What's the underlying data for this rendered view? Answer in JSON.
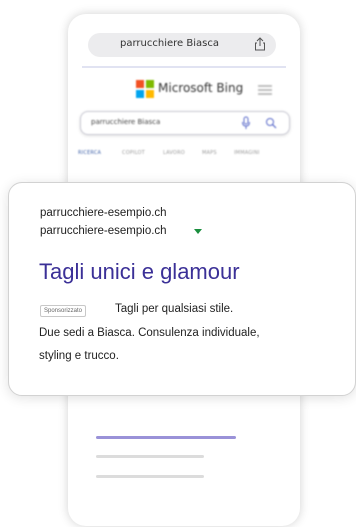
{
  "browser": {
    "url_text": "parrucchiere Biasca",
    "share_icon": "share-icon"
  },
  "bing": {
    "brand": "Microsoft Bing",
    "logo_colors": [
      "#f25022",
      "#7fba00",
      "#00a4ef",
      "#ffb900"
    ],
    "menu_icon": "hamburger-icon"
  },
  "search": {
    "query": "parrucchiere Biasca",
    "mic_icon": "microphone-icon",
    "search_icon": "search-icon"
  },
  "tabs": [
    "RICERCA",
    "COPILOT",
    "LAVORO",
    "MAPS",
    "IMMAGINI"
  ],
  "ad": {
    "domain_line1": "parrucchiere-esempio.ch",
    "domain_line2": "parrucchiere-esempio.ch",
    "title": "Tagli unici e glamour",
    "sponsored_label": "Sponsorizzato",
    "description_line1": "Tagli per qualsiasi stile.",
    "description_line2": "Due sedi a Biasca. Consulenza individuale,",
    "description_line3": "styling e trucco.",
    "title_color": "#3b3097",
    "caret_color": "#1a8e3e"
  }
}
